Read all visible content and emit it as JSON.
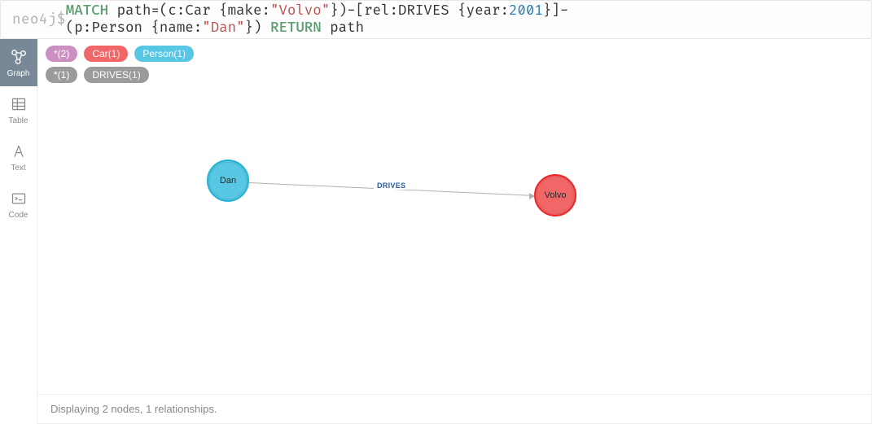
{
  "prompt": "neo4j$ ",
  "query": {
    "kw_match": "MATCH",
    "path_ident": "path",
    "eq": "=",
    "open1": "(",
    "var_c": "c",
    "colon": ":",
    "label_car": "Car",
    "brace_o": "{",
    "prop_make": "make",
    "str_volvo": "\"Volvo\"",
    "brace_c": "}",
    "close1": ")",
    "dash": "-",
    "brack_o": "[",
    "var_rel": "rel",
    "label_drives": "DRIVES",
    "prop_year": "year",
    "num_year": "2001",
    "brack_c": "]",
    "var_p": "p",
    "label_person": "Person",
    "prop_name": "name",
    "str_dan": "\"Dan\"",
    "kw_return": "RETURN",
    "ret_ident": "path"
  },
  "sidebar": {
    "graph": "Graph",
    "table": "Table",
    "text": "Text",
    "code": "Code"
  },
  "legend": {
    "nodes_star": "*(2)",
    "car": "Car",
    "car_count": "(1)",
    "person": "Person",
    "person_count": "(1)",
    "rels_star": "*(1)",
    "drives": "DRIVES",
    "drives_count": "(1)"
  },
  "graph": {
    "node_dan": "Dan",
    "node_volvo": "Volvo",
    "edge_label": "DRIVES"
  },
  "footer": "Displaying 2 nodes, 1 relationships."
}
